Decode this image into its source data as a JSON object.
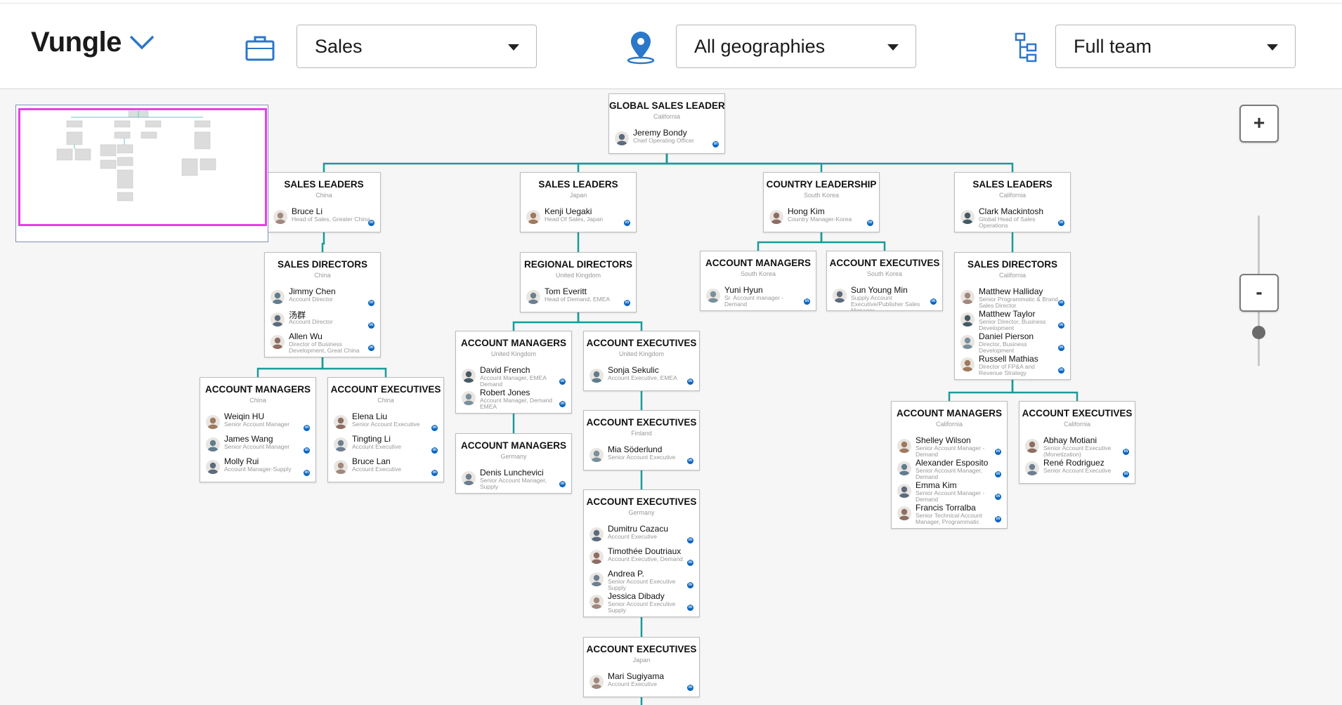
{
  "header": {
    "company": "Vungle",
    "filters": {
      "department": "Sales",
      "geography": "All geographies",
      "team": "Full team"
    },
    "icons": {
      "company_menu": "chevron-down-icon",
      "department": "briefcase-icon",
      "geography": "location-pin-icon",
      "team": "org-tree-icon"
    }
  },
  "colors": {
    "accent": "#2b77c9",
    "connector": "#1b9a9a",
    "linkedin": "#0a66c2",
    "minimap_viewport": "#e83ee8"
  },
  "zoom": {
    "plus": "+",
    "minus": "-"
  },
  "org": [
    {
      "title": "GLOBAL SALES LEADERSHIP",
      "location": "California",
      "people": [
        {
          "name": "Jeremy Bondy",
          "role": "Chief Operating Officer"
        }
      ]
    },
    {
      "title": "SALES LEADERS",
      "location": "China",
      "people": [
        {
          "name": "Bruce Li",
          "role": "Head of Sales, Greater China"
        }
      ]
    },
    {
      "title": "SALES LEADERS",
      "location": "Japan",
      "people": [
        {
          "name": "Kenji Uegaki",
          "role": "Head Of Sales, Japan"
        }
      ]
    },
    {
      "title": "COUNTRY LEADERSHIP",
      "location": "South Korea",
      "people": [
        {
          "name": "Hong Kim",
          "role": "Country Manager-Korea"
        }
      ]
    },
    {
      "title": "SALES LEADERS",
      "location": "California",
      "people": [
        {
          "name": "Clark Mackintosh",
          "role": "Global Head of Sales Operations"
        }
      ]
    },
    {
      "title": "SALES DIRECTORS",
      "location": "China",
      "people": [
        {
          "name": "Jimmy Chen",
          "role": "Account Director"
        },
        {
          "name": "汤群",
          "role": "Account Director"
        },
        {
          "name": "Allen Wu",
          "role": "Director of Business Development, Great China"
        }
      ]
    },
    {
      "title": "REGIONAL DIRECTORS",
      "location": "United Kingdom",
      "people": [
        {
          "name": "Tom Everitt",
          "role": "Head of Demand, EMEA"
        }
      ]
    },
    {
      "title": "ACCOUNT MANAGERS",
      "location": "South Korea",
      "people": [
        {
          "name": "Yuni Hyun",
          "role": "Sr. Account manager -Demand"
        }
      ]
    },
    {
      "title": "ACCOUNT EXECUTIVES",
      "location": "South Korea",
      "people": [
        {
          "name": "Sun Young Min",
          "role": "Supply Account Executive/Publisher Sales Manager"
        }
      ]
    },
    {
      "title": "SALES DIRECTORS",
      "location": "California",
      "people": [
        {
          "name": "Matthew Halliday",
          "role": "Senior Programmatic & Brand Sales Director"
        },
        {
          "name": "Matthew Taylor",
          "role": "Senior Director, Business Development"
        },
        {
          "name": "Daniel Pierson",
          "role": "Director, Business Development"
        },
        {
          "name": "Russell Mathias",
          "role": "Director of FP&A and Revenue Strategy"
        }
      ]
    },
    {
      "title": "ACCOUNT MANAGERS",
      "location": "China",
      "people": [
        {
          "name": "Weiqin HU",
          "role": "Senior Account Manager"
        },
        {
          "name": "James Wang",
          "role": "Senior Account Manager"
        },
        {
          "name": "Molly Rui",
          "role": "Account Manager-Supply"
        }
      ]
    },
    {
      "title": "ACCOUNT EXECUTIVES",
      "location": "China",
      "people": [
        {
          "name": "Elena Liu",
          "role": "Senior Account Executive"
        },
        {
          "name": "Tingting Li",
          "role": "Account Executive"
        },
        {
          "name": "Bruce Lan",
          "role": "Account Executive"
        }
      ]
    },
    {
      "title": "ACCOUNT MANAGERS",
      "location": "United Kingdom",
      "people": [
        {
          "name": "David French",
          "role": "Account Manager, EMEA Demand"
        },
        {
          "name": "Robert Jones",
          "role": "Account Manager, Demand EMEA"
        }
      ]
    },
    {
      "title": "ACCOUNT EXECUTIVES",
      "location": "United Kingdom",
      "people": [
        {
          "name": "Sonja Sekulic",
          "role": "Account Executive, EMEA"
        }
      ]
    },
    {
      "title": "ACCOUNT MANAGERS",
      "location": "Germany",
      "people": [
        {
          "name": "Denis Lunchevici",
          "role": "Senior Account Manager, Supply"
        }
      ]
    },
    {
      "title": "ACCOUNT EXECUTIVES",
      "location": "Finland",
      "people": [
        {
          "name": "Mia Söderlund",
          "role": "Senior Account Executive"
        }
      ]
    },
    {
      "title": "ACCOUNT EXECUTIVES",
      "location": "Germany",
      "people": [
        {
          "name": "Dumitru Cazacu",
          "role": "Account Executive"
        },
        {
          "name": "Timothée Doutriaux",
          "role": "Account Executive, Demand"
        },
        {
          "name": "Andrea P.",
          "role": "Senior Account Executive Supply"
        },
        {
          "name": "Jessica Dibady",
          "role": "Senior Account Executive Supply"
        }
      ]
    },
    {
      "title": "ACCOUNT EXECUTIVES",
      "location": "Japan",
      "people": [
        {
          "name": "Mari Sugiyama",
          "role": "Account Executive"
        }
      ]
    },
    {
      "title": "ACCOUNT MANAGERS",
      "location": "California",
      "people": [
        {
          "name": "Shelley Wilson",
          "role": "Senior Account Manager - Demand"
        },
        {
          "name": "Alexander Esposito",
          "role": "Senior Account Manager, Demand"
        },
        {
          "name": "Emma Kim",
          "role": "Senior Account Manager - Demand"
        },
        {
          "name": "Francis Torralba",
          "role": "Senior Technical Account Manager, Programmatic"
        }
      ]
    },
    {
      "title": "ACCOUNT EXECUTIVES",
      "location": "California",
      "people": [
        {
          "name": "Abhay Motiani",
          "role": "Senior Account Executive (Monetization)"
        },
        {
          "name": "René Rodriguez",
          "role": "Senior Account Executive"
        }
      ]
    }
  ]
}
